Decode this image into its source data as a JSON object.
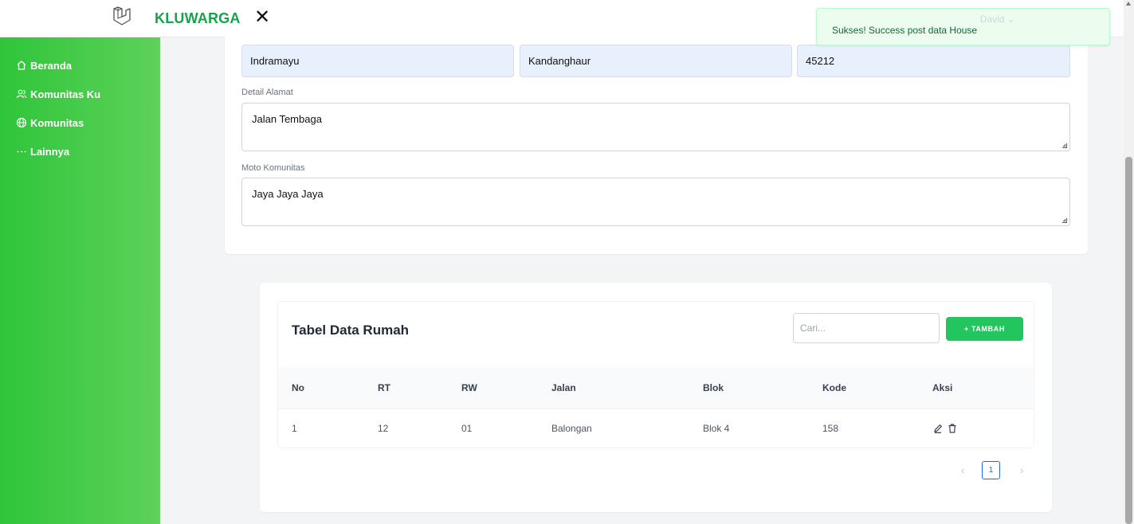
{
  "app": {
    "brand": "KLUWARGA",
    "close_symbol": "✕",
    "logo_icon": "laravel-logo-icon"
  },
  "toast": {
    "message": "Sukses! Success post data House",
    "ghost_user": "David ⌄"
  },
  "sidebar": {
    "items": [
      {
        "label": "Beranda",
        "icon": "home-icon"
      },
      {
        "label": "Komunitas Ku",
        "icon": "users-icon"
      },
      {
        "label": "Komunitas",
        "icon": "globe-icon"
      },
      {
        "label": "Lainnya",
        "icon": "more-icon"
      }
    ]
  },
  "form": {
    "city": "Indramayu",
    "district": "Kandanghaur",
    "postal_code": "45212",
    "detail_label": "Detail Alamat",
    "detail_value": "Jalan Tembaga",
    "motto_label": "Moto Komunitas",
    "motto_value": "Jaya Jaya Jaya"
  },
  "table": {
    "title": "Tabel Data Rumah",
    "search_placeholder": "Cari...",
    "add_label": "+ TAMBAH",
    "columns": [
      "No",
      "RT",
      "RW",
      "Jalan",
      "Blok",
      "Kode",
      "Aksi"
    ],
    "rows": [
      {
        "no": "1",
        "rt": "12",
        "rw": "01",
        "jalan": "Balongan",
        "blok": "Blok 4",
        "kode": "158"
      }
    ],
    "pagination": {
      "current": "1",
      "prev": "‹",
      "next": "›"
    }
  },
  "colors": {
    "accent": "#22c55e",
    "sidebar_start": "#2fc53a",
    "sidebar_end": "#5ed15a",
    "brand_text": "#16a34a"
  }
}
